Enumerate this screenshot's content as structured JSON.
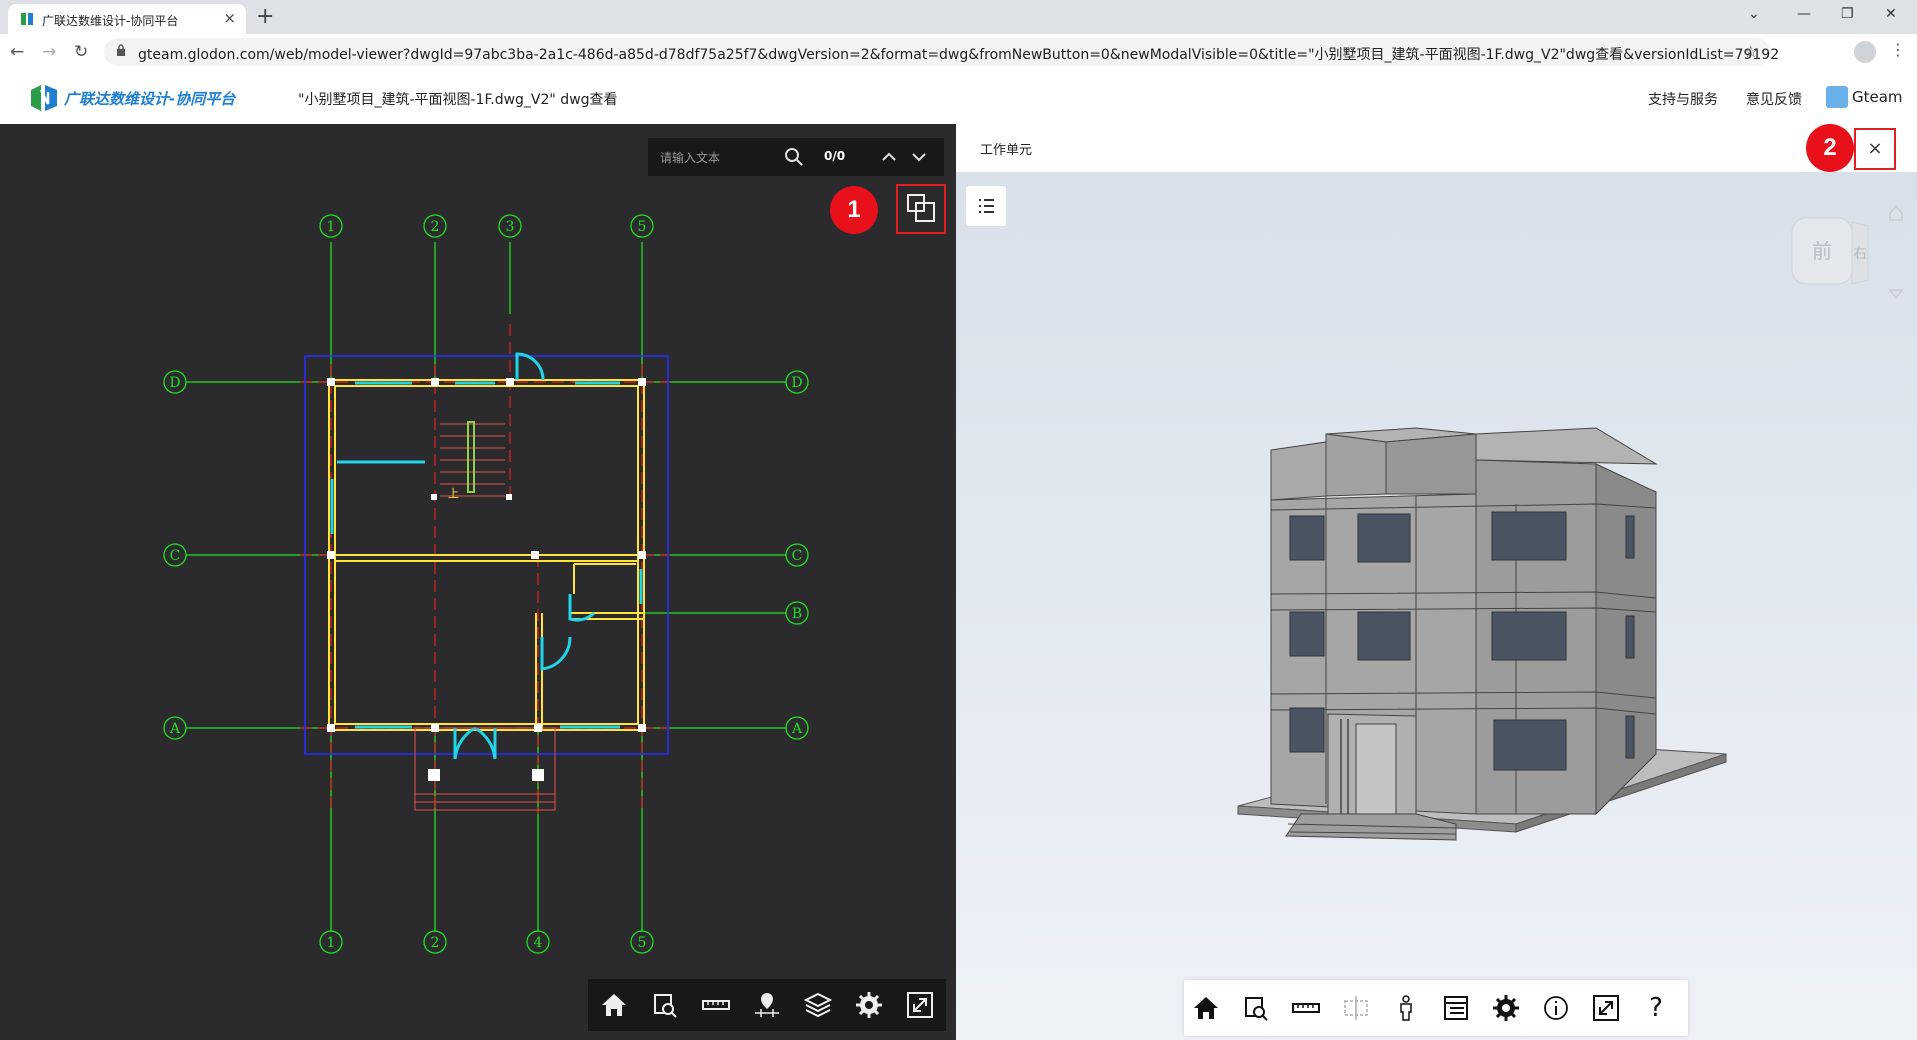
{
  "browser": {
    "tab_title": "广联达数维设计-协同平台",
    "url": "gteam.glodon.com/web/model-viewer?dwgId=97abc3ba-2a1c-486d-a85d-d78df75a25f7&dwgVersion=2&format=dwg&fromNewButton=0&newModalVisible=0&title=\"小别墅项目_建筑-平面视图-1F.dwg_V2\"dwg查看&versionIdList=79192"
  },
  "app": {
    "brand": "广联达数维设计-协同平台",
    "doc_title": "\"小别墅项目_建筑-平面视图-1F.dwg_V2\"  dwg查看",
    "links": [
      "支持与服务",
      "意见反馈"
    ],
    "user": "Gteam"
  },
  "left_viewer": {
    "search_placeholder": "请输入文本",
    "search_count": "0/0",
    "marker1": "1",
    "grid_top": [
      "1",
      "2",
      "3",
      "5"
    ],
    "grid_bottom": [
      "1",
      "2",
      "4",
      "5"
    ],
    "grid_left": [
      "D",
      "C",
      "A"
    ],
    "grid_right": [
      "D",
      "C",
      "B",
      "A"
    ],
    "stair_label": "上",
    "toolbar": [
      "home-icon",
      "zoom-window-icon",
      "measure-icon",
      "locate-icon",
      "layers-icon",
      "settings-icon",
      "fullscreen-icon"
    ]
  },
  "right_viewer": {
    "title": "工作单元",
    "close_label": "×",
    "marker2": "2",
    "viewcube_front": "前",
    "viewcube_right": "右",
    "toolbar": [
      "home-icon",
      "zoom-window-icon",
      "measure-icon",
      "section-icon",
      "person-icon",
      "properties-icon",
      "settings-icon",
      "info-icon",
      "fullscreen-icon",
      "help-icon"
    ],
    "help_label": "?"
  },
  "colors": {
    "cad_bg": "#2b2b2e",
    "grid_line": "#20e020",
    "wall": "#ffe23a",
    "window": "#22d4e8",
    "axis_red": "#e02020",
    "boundary": "#2230ff",
    "marker": "#e8101a"
  }
}
